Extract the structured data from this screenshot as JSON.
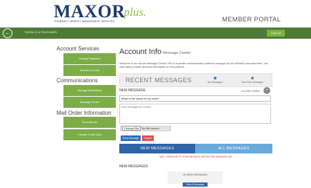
{
  "header": {
    "logo_main": "MAXOR",
    "logo_plus": "plus.",
    "logo_tagline": "PHARMACY BENEFIT MANAGEMENT SERVICES",
    "portal_title": "MEMBER PORTAL"
  },
  "navbar": {
    "back_icon": "arrow-left-circle-icon",
    "back_label": "SHOW FLU FEATURES",
    "logout_label": "Log Out",
    "bar_color": "#4d7a36"
  },
  "sidebar": {
    "sections": [
      {
        "heading": "Account Services",
        "items": [
          {
            "label": "Change Password"
          },
          {
            "label": "Member ID Card"
          }
        ]
      },
      {
        "heading": "Communications",
        "items": [
          {
            "label": "Manage Notifications"
          },
          {
            "label": "Message Center"
          }
        ]
      },
      {
        "heading": "Mail Order Information",
        "items": [
          {
            "label": "Personal Info"
          },
          {
            "label": "Change Credit Card"
          }
        ]
      }
    ],
    "button_color": "#7dad47"
  },
  "main": {
    "title": "Account Info",
    "subtitle": "Message Center",
    "intro": "Welcome to our secure Message Center! This is a private communication platform managed by our Member Advocate team. You may safely provide personal information on this platform.",
    "recent": {
      "title": "RECENT MESSAGES",
      "stats": [
        {
          "label": "My Messages",
          "color": "#3a7bd5"
        },
        {
          "label": "New Plus Messages",
          "color": "#3cb24a"
        }
      ]
    },
    "new_message": {
      "label": "NEW MESSAGE",
      "close_label": "CLOSE FORM",
      "close_icon": "minus-icon",
      "subject_value": "What is the status of my order?",
      "body_placeholder": "Enter message text content",
      "choose_file_label": "Choose File",
      "no_file_label": "No file chosen",
      "send_label": "Send Message",
      "cancel_label": "Cancel"
    },
    "tabs": [
      {
        "label": "NEW MESSAGES"
      },
      {
        "label": "ALL MESSAGES"
      }
    ],
    "notice": "WE'LL RESPOND TO YOUR MESSAGE WITHIN ONE BUSINESS DAY",
    "new_messages": {
      "label": "NEW MESSAGES:",
      "empty_text": "NO NEW MESSAGES",
      "view_all_label": "View All Messages"
    }
  }
}
